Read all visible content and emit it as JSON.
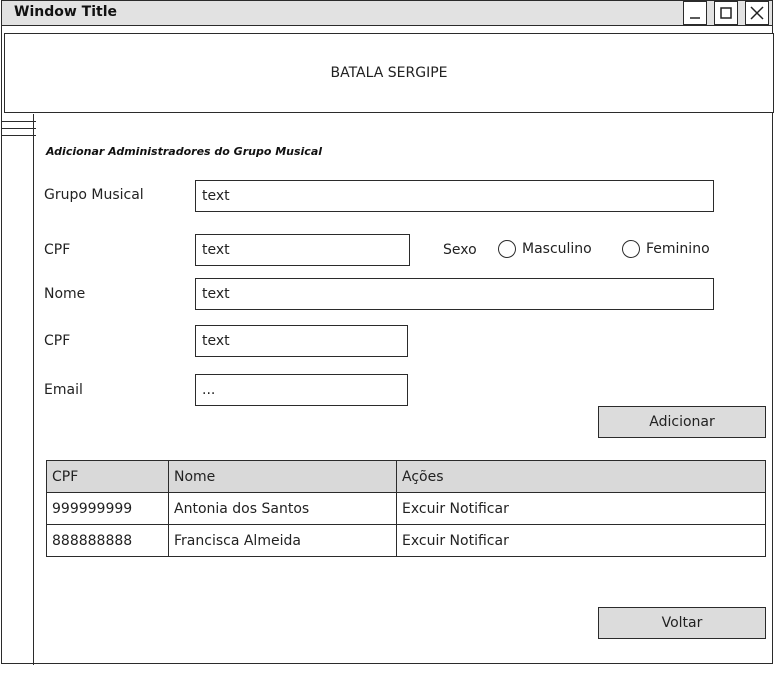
{
  "window": {
    "title": "Window Title"
  },
  "header": {
    "title": "BATALA SERGIPE"
  },
  "form": {
    "section_title": "Adicionar Administradores do Grupo Musical",
    "grupo_label": "Grupo Musical",
    "grupo_value": "text",
    "cpf1_label": "CPF",
    "cpf1_value": "text",
    "sexo_label": "Sexo",
    "sexo_options": [
      "Masculino",
      "Feminino"
    ],
    "nome_label": "Nome",
    "nome_value": "text",
    "cpf2_label": "CPF",
    "cpf2_value": "text",
    "email_label": "Email",
    "email_value": "..."
  },
  "buttons": {
    "add": "Adicionar",
    "back": "Voltar"
  },
  "table": {
    "headers": [
      "CPF",
      "Nome",
      "Ações"
    ],
    "rows": [
      [
        "999999999",
        "Antonia dos Santos",
        "Excuir Notificar"
      ],
      [
        "888888888",
        "Francisca Almeida",
        "Excuir Notificar"
      ]
    ]
  }
}
